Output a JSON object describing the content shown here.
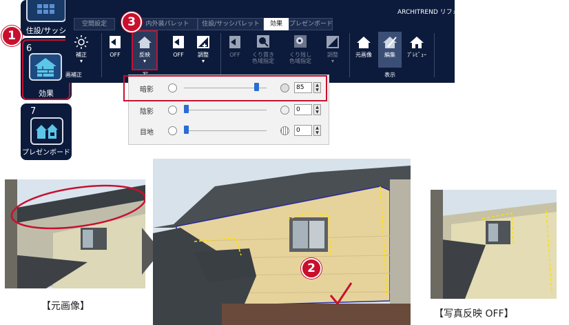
{
  "app": {
    "brand": "ARCHITREND リフォ"
  },
  "sidebar": {
    "items": [
      {
        "label": "住設/サッシ"
      },
      {
        "number": "6",
        "label": "効果"
      },
      {
        "number": "7",
        "label": "プレゼンボード"
      }
    ]
  },
  "ribbon": {
    "tabs": [
      "空間設定",
      "内外装パレット",
      "住設/サッシパレット",
      "効果",
      "プレゼンボード"
    ],
    "active_tab": "効果",
    "buttons": {
      "hosei": "補正",
      "off1": "OFF",
      "hanei": "反映",
      "off2": "OFF",
      "chosei1": "調整",
      "off3": "OFF",
      "kurinuki": [
        "くり貫き",
        "色域指定"
      ],
      "kurinokoshi": [
        "くり残し",
        "色域指定"
      ],
      "chosei2": "調整",
      "motogazo": "元画像",
      "henshu": "編集",
      "preview": "ﾌﾟﾚﾋﾞｭｰ"
    },
    "groups": {
      "hosei_group": "画補正",
      "photo_group": "写",
      "display": "表示"
    }
  },
  "panel": {
    "rows": [
      {
        "label": "暗影",
        "value": "85",
        "level": 0.85
      },
      {
        "label": "陰影",
        "value": "0",
        "level": 0
      },
      {
        "label": "目地",
        "value": "0",
        "level": 0
      }
    ]
  },
  "badges": [
    "1",
    "2",
    "3"
  ],
  "captions": {
    "left": "【元画像】",
    "right": "【写真反映 OFF】"
  },
  "colors": {
    "ribbon_bg": "#0c1b3c",
    "highlight": "#c8102e",
    "slider_thumb": "#2a6dd2",
    "wall": "#e6d39b"
  }
}
